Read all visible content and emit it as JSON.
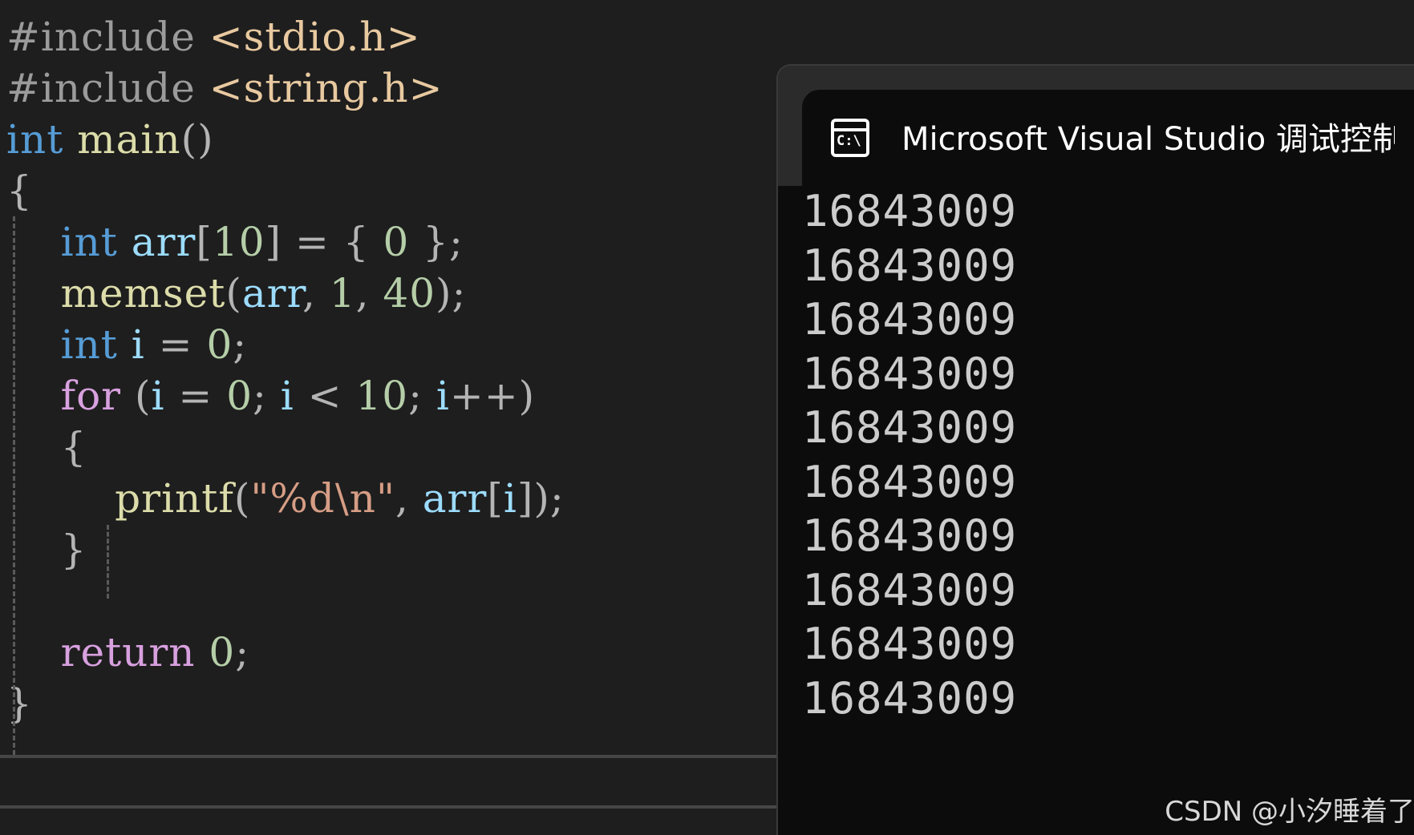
{
  "editor": {
    "lines": [
      [
        {
          "t": "#include ",
          "c": "prep"
        },
        {
          "t": "<stdio.h>",
          "c": "hdr"
        }
      ],
      [
        {
          "t": "#include ",
          "c": "prep"
        },
        {
          "t": "<string.h>",
          "c": "hdr"
        }
      ],
      [
        {
          "t": "int",
          "c": "kw"
        },
        {
          "t": " ",
          "c": "pun"
        },
        {
          "t": "main",
          "c": "fn"
        },
        {
          "t": "()",
          "c": "pun"
        }
      ],
      [
        {
          "t": "{",
          "c": "pun"
        }
      ],
      [
        {
          "t": "    ",
          "c": "pun"
        },
        {
          "t": "int",
          "c": "kw"
        },
        {
          "t": " ",
          "c": "pun"
        },
        {
          "t": "arr",
          "c": "var"
        },
        {
          "t": "[",
          "c": "pun"
        },
        {
          "t": "10",
          "c": "num"
        },
        {
          "t": "] = { ",
          "c": "pun"
        },
        {
          "t": "0",
          "c": "num"
        },
        {
          "t": " };",
          "c": "pun"
        }
      ],
      [
        {
          "t": "    ",
          "c": "pun"
        },
        {
          "t": "memset",
          "c": "fn"
        },
        {
          "t": "(",
          "c": "pun"
        },
        {
          "t": "arr",
          "c": "var"
        },
        {
          "t": ", ",
          "c": "pun"
        },
        {
          "t": "1",
          "c": "num"
        },
        {
          "t": ", ",
          "c": "pun"
        },
        {
          "t": "40",
          "c": "num"
        },
        {
          "t": ");",
          "c": "pun"
        }
      ],
      [
        {
          "t": "    ",
          "c": "pun"
        },
        {
          "t": "int",
          "c": "kw"
        },
        {
          "t": " ",
          "c": "pun"
        },
        {
          "t": "i",
          "c": "var"
        },
        {
          "t": " = ",
          "c": "pun"
        },
        {
          "t": "0",
          "c": "num"
        },
        {
          "t": ";",
          "c": "pun"
        }
      ],
      [
        {
          "t": "    ",
          "c": "pun"
        },
        {
          "t": "for",
          "c": "ctl"
        },
        {
          "t": " (",
          "c": "pun"
        },
        {
          "t": "i",
          "c": "var"
        },
        {
          "t": " = ",
          "c": "pun"
        },
        {
          "t": "0",
          "c": "num"
        },
        {
          "t": "; ",
          "c": "pun"
        },
        {
          "t": "i",
          "c": "var"
        },
        {
          "t": " < ",
          "c": "pun"
        },
        {
          "t": "10",
          "c": "num"
        },
        {
          "t": "; ",
          "c": "pun"
        },
        {
          "t": "i",
          "c": "var"
        },
        {
          "t": "++)",
          "c": "pun"
        }
      ],
      [
        {
          "t": "    {",
          "c": "pun"
        }
      ],
      [
        {
          "t": "        ",
          "c": "pun"
        },
        {
          "t": "printf",
          "c": "fn"
        },
        {
          "t": "(",
          "c": "pun"
        },
        {
          "t": "\"%d\\n\"",
          "c": "str"
        },
        {
          "t": ", ",
          "c": "pun"
        },
        {
          "t": "arr",
          "c": "var"
        },
        {
          "t": "[",
          "c": "pun"
        },
        {
          "t": "i",
          "c": "var"
        },
        {
          "t": "]);",
          "c": "pun"
        }
      ],
      [
        {
          "t": "    }",
          "c": "pun"
        }
      ],
      [
        {
          "t": "",
          "c": "pun"
        }
      ],
      [
        {
          "t": "    ",
          "c": "pun"
        },
        {
          "t": "return",
          "c": "ctl"
        },
        {
          "t": " ",
          "c": "pun"
        },
        {
          "t": "0",
          "c": "num"
        },
        {
          "t": ";",
          "c": "pun"
        }
      ],
      [
        {
          "t": "}",
          "c": "pun"
        }
      ]
    ]
  },
  "console": {
    "icon": "cmd-icon",
    "icon_text": "C:\\",
    "title": "Microsoft Visual Studio 调试控制台",
    "output": [
      "16843009",
      "16843009",
      "16843009",
      "16843009",
      "16843009",
      "16843009",
      "16843009",
      "16843009",
      "16843009",
      "16843009"
    ]
  },
  "watermark": "CSDN @小汐睡着了"
}
